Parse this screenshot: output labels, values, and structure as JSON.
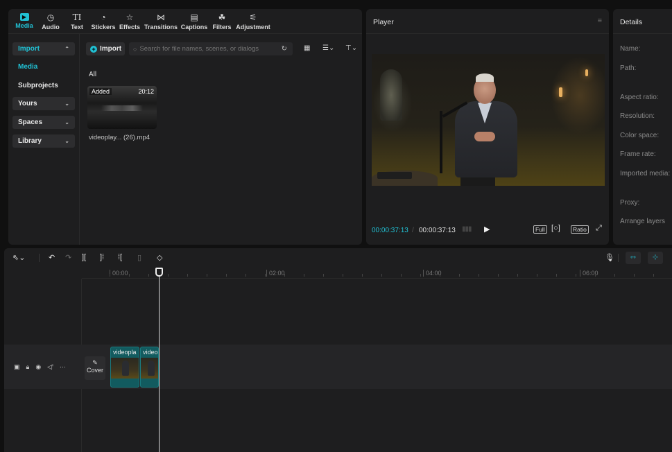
{
  "toolbar": {
    "tabs": [
      {
        "label": "Media",
        "icon": "media-icon",
        "active": true
      },
      {
        "label": "Audio",
        "icon": "audio-icon"
      },
      {
        "label": "Text",
        "icon": "text-icon"
      },
      {
        "label": "Stickers",
        "icon": "sticker-icon"
      },
      {
        "label": "Effects",
        "icon": "effects-icon"
      },
      {
        "label": "Transitions",
        "icon": "transitions-icon"
      },
      {
        "label": "Captions",
        "icon": "captions-icon"
      },
      {
        "label": "Filters",
        "icon": "filters-icon"
      },
      {
        "label": "Adjustment",
        "icon": "adjustment-icon"
      }
    ]
  },
  "sidebar": {
    "items": [
      {
        "label": "Import"
      },
      {
        "label": "Media"
      },
      {
        "label": "Subprojects"
      },
      {
        "label": "Yours"
      },
      {
        "label": "Spaces"
      },
      {
        "label": "Library"
      }
    ]
  },
  "media": {
    "import_label": "Import",
    "search_placeholder": "Search for file names, scenes, or dialogs",
    "filter_label": "All",
    "item": {
      "badge": "Added",
      "duration": "20:12",
      "name": "videoplay... (26).mp4"
    }
  },
  "player": {
    "title": "Player",
    "current_time": "00:00:37:13",
    "separator": "/",
    "total_time": "00:00:37:13",
    "full_label": "Full",
    "ratio_label": "Ratio"
  },
  "details": {
    "title": "Details",
    "fields": [
      "Name:",
      "Path:",
      "Aspect ratio:",
      "Resolution:",
      "Color space:",
      "Frame rate:",
      "Imported media:",
      "Proxy:",
      "Arrange layers"
    ]
  },
  "timeline": {
    "ruler_labels": [
      "00:00",
      "02:00",
      "04:00",
      "06:00"
    ],
    "cover_label": "Cover",
    "clips": [
      {
        "name": "videopla"
      },
      {
        "name": "videop"
      }
    ]
  },
  "colors": {
    "accent": "#21c1d4",
    "clip": "#125b5f"
  }
}
